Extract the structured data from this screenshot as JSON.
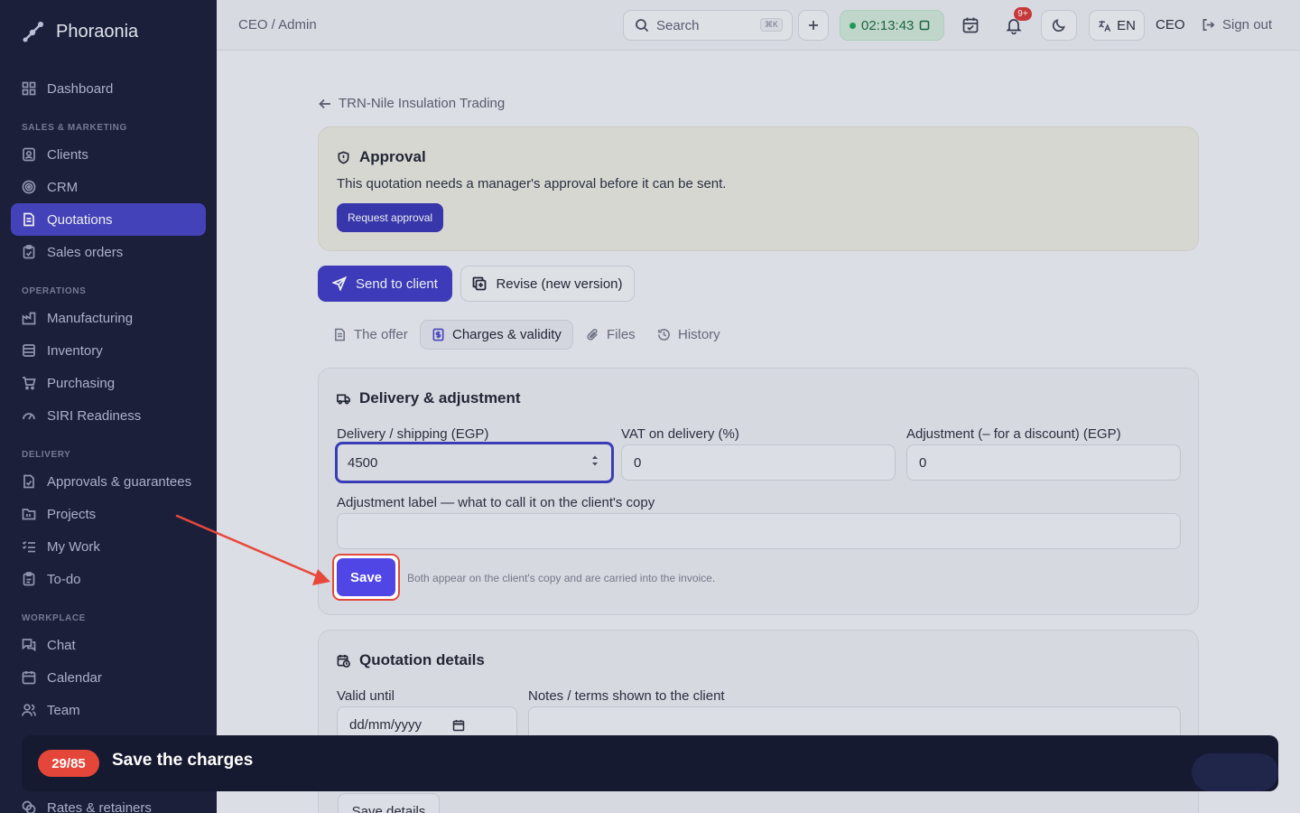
{
  "app": {
    "brand": "Phoraonia"
  },
  "sidebar": {
    "items": [
      {
        "label": "Dashboard",
        "icon": "grid-icon"
      },
      {
        "label": "Clients",
        "icon": "contact-icon"
      },
      {
        "label": "CRM",
        "icon": "target-icon"
      },
      {
        "label": "Quotations",
        "icon": "document-icon",
        "active": true
      },
      {
        "label": "Sales orders",
        "icon": "clipboard-icon"
      },
      {
        "label": "Manufacturing",
        "icon": "factory-icon"
      },
      {
        "label": "Inventory",
        "icon": "box-icon"
      },
      {
        "label": "Purchasing",
        "icon": "cart-icon"
      },
      {
        "label": "SIRI Readiness",
        "icon": "gauge-icon"
      },
      {
        "label": "Approvals & guarantees",
        "icon": "file-check-icon"
      },
      {
        "label": "Projects",
        "icon": "folder-icon"
      },
      {
        "label": "My Work",
        "icon": "list-check-icon"
      },
      {
        "label": "To-do",
        "icon": "clipboard-check-icon"
      },
      {
        "label": "Chat",
        "icon": "chat-icon"
      },
      {
        "label": "Calendar",
        "icon": "calendar-icon"
      },
      {
        "label": "Team",
        "icon": "users-icon"
      },
      {
        "label": "Rates & retainers",
        "icon": "coins-icon"
      }
    ],
    "sections": {
      "sales": "SALES & MARKETING",
      "operations": "OPERATIONS",
      "delivery": "DELIVERY",
      "workplace": "WORKPLACE"
    }
  },
  "topbar": {
    "breadcrumb": "CEO / Admin",
    "search_label": "Search",
    "search_shortcut": "⌘K",
    "timer": "02:13:43",
    "notifications_count": "9+",
    "language": "EN",
    "role": "CEO",
    "signout_label": "Sign out"
  },
  "page": {
    "back_label": "TRN-Nile Insulation Trading",
    "approval": {
      "title": "Approval",
      "text": "This quotation needs a manager's approval before it can be sent.",
      "button": "Request approval"
    },
    "actions": {
      "send": "Send to client",
      "revise": "Revise (new version)"
    },
    "tabs": [
      {
        "label": "The offer",
        "icon": "file-text-icon"
      },
      {
        "label": "Charges & validity",
        "icon": "dollar-doc-icon",
        "active": true
      },
      {
        "label": "Files",
        "icon": "paperclip-icon"
      },
      {
        "label": "History",
        "icon": "history-icon"
      }
    ],
    "delivery": {
      "title": "Delivery & adjustment",
      "shipping_label": "Delivery / shipping (EGP)",
      "shipping_value": "4500",
      "vat_label": "VAT on delivery (%)",
      "vat_value": "0",
      "adjustment_label": "Adjustment (– for a discount) (EGP)",
      "adjustment_value": "0",
      "adj_name_label": "Adjustment label — what to call it on the client's copy",
      "adj_name_value": "",
      "save": "Save",
      "hint": "Both appear on the client's copy and are carried into the invoice."
    },
    "quotation_details": {
      "title": "Quotation details",
      "valid_until_label": "Valid until",
      "valid_until_placeholder": "dd/mm/yyyy",
      "notes_label": "Notes / terms shown to the client",
      "save": "Save details"
    }
  },
  "tour": {
    "step": "29/85",
    "title": "Save the charges"
  },
  "colors": {
    "accent": "#4f46e5",
    "sidebar_bg": "#1c1f3a",
    "highlight": "#e14a3c",
    "timer_green": "#21a35a"
  }
}
